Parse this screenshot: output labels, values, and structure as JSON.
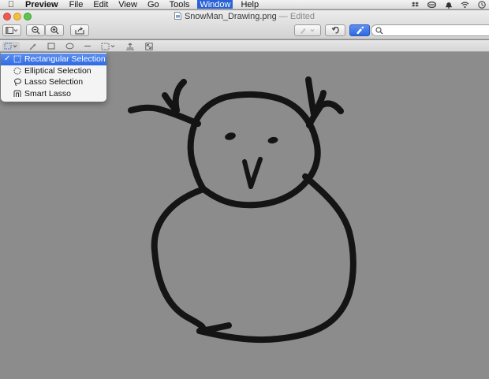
{
  "menubar": {
    "app_name": "Preview",
    "items": [
      "File",
      "Edit",
      "View",
      "Go",
      "Tools",
      "Window",
      "Help"
    ],
    "active_item": "Window",
    "status_icons": [
      "dropbox-icon",
      "sync-icon",
      "notification-icon",
      "wifi-icon",
      "clock-icon"
    ]
  },
  "window": {
    "title": "SnowMan_Drawing.png",
    "edited_suffix": "— Edited"
  },
  "toolbar": {
    "search_placeholder": ""
  },
  "selection_menu": {
    "items": [
      {
        "label": "Rectangular Selection",
        "icon": "rectangle-selection-icon",
        "checked": true
      },
      {
        "label": "Elliptical Selection",
        "icon": "elliptical-selection-icon",
        "checked": false
      },
      {
        "label": "Lasso Selection",
        "icon": "lasso-selection-icon",
        "checked": false
      },
      {
        "label": "Smart Lasso",
        "icon": "smart-lasso-icon",
        "checked": false
      }
    ],
    "check_mark": "✓"
  },
  "colors": {
    "canvas": "#8c8c8c",
    "selection_highlight": "#2e6ae3",
    "ink": "#141414"
  }
}
